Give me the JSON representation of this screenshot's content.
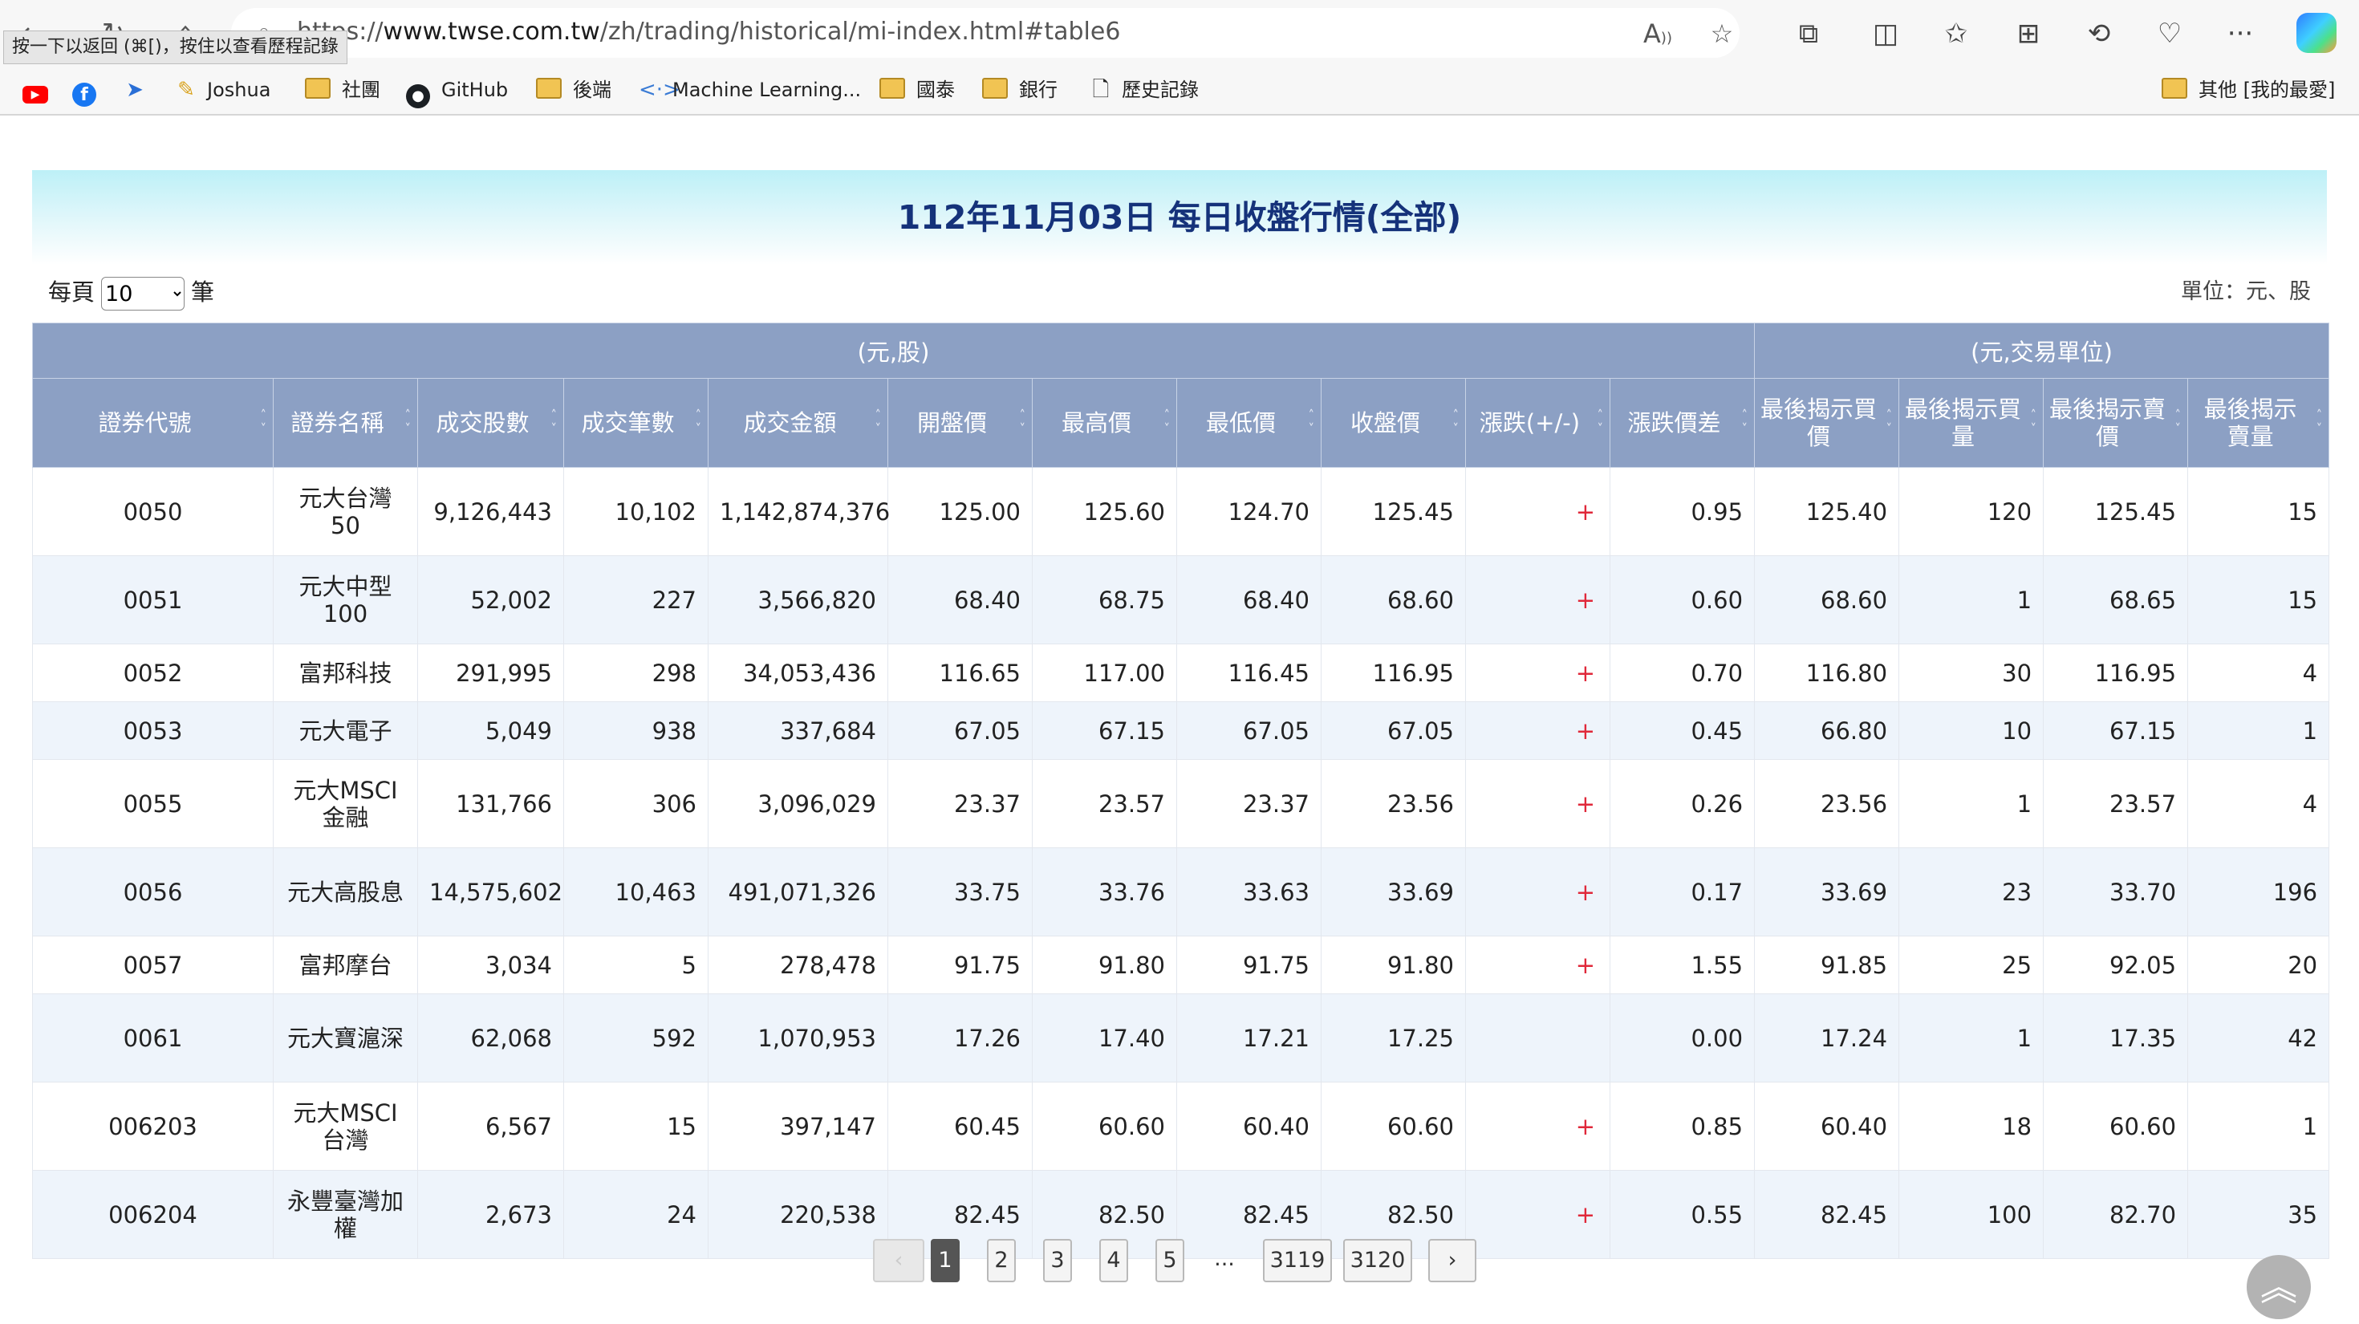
{
  "browser": {
    "url_prefix": "https://",
    "url_host": "www.twse.com.tw",
    "url_path": "/zh/trading/historical/mi-index.html#table6",
    "back_tooltip": "按一下以返回 (⌘[)，按住以查看歷程記錄"
  },
  "bookmarks": {
    "items": [
      {
        "label": "",
        "icon": "youtube-icon"
      },
      {
        "label": "",
        "icon": "facebook-icon"
      },
      {
        "label": "",
        "icon": "send-icon"
      },
      {
        "label": "Joshua",
        "icon": "pencil-icon"
      },
      {
        "label": "社團",
        "icon": "folder-icon"
      },
      {
        "label": "GitHub",
        "icon": "github-icon"
      },
      {
        "label": "後端",
        "icon": "folder-icon"
      },
      {
        "label": "Machine Learning...",
        "icon": "code-icon"
      },
      {
        "label": "國泰",
        "icon": "folder-icon"
      },
      {
        "label": "銀行",
        "icon": "folder-icon"
      },
      {
        "label": "歷史記錄",
        "icon": "page-icon"
      }
    ],
    "other": "其他 [我的最愛]"
  },
  "page": {
    "title": "112年11月03日 每日收盤行情(全部)",
    "per_page_label": "每頁",
    "per_page_value": "10",
    "per_page_suffix": "筆",
    "unit_label": "單位：元、股"
  },
  "table": {
    "groups": [
      "(元,股)",
      "(元,交易單位)"
    ],
    "headers": [
      "證券代號",
      "證券名稱",
      "成交股數",
      "成交筆數",
      "成交金額",
      "開盤價",
      "最高價",
      "最低價",
      "收盤價",
      "漲跌(+/-)",
      "漲跌價差",
      "最後揭示買價",
      "最後揭示買量",
      "最後揭示賣價",
      "最後揭示賣量"
    ],
    "rows": [
      [
        "0050",
        "元大台灣50",
        "9,126,443",
        "10,102",
        "1,142,874,376",
        "125.00",
        "125.60",
        "124.70",
        "125.45",
        "+",
        "0.95",
        "125.40",
        "120",
        "125.45",
        "15"
      ],
      [
        "0051",
        "元大中型100",
        "52,002",
        "227",
        "3,566,820",
        "68.40",
        "68.75",
        "68.40",
        "68.60",
        "+",
        "0.60",
        "68.60",
        "1",
        "68.65",
        "15"
      ],
      [
        "0052",
        "富邦科技",
        "291,995",
        "298",
        "34,053,436",
        "116.65",
        "117.00",
        "116.45",
        "116.95",
        "+",
        "0.70",
        "116.80",
        "30",
        "116.95",
        "4"
      ],
      [
        "0053",
        "元大電子",
        "5,049",
        "938",
        "337,684",
        "67.05",
        "67.15",
        "67.05",
        "67.05",
        "+",
        "0.45",
        "66.80",
        "10",
        "67.15",
        "1"
      ],
      [
        "0055",
        "元大MSCI金融",
        "131,766",
        "306",
        "3,096,029",
        "23.37",
        "23.57",
        "23.37",
        "23.56",
        "+",
        "0.26",
        "23.56",
        "1",
        "23.57",
        "4"
      ],
      [
        "0056",
        "元大高股息",
        "14,575,602",
        "10,463",
        "491,071,326",
        "33.75",
        "33.76",
        "33.63",
        "33.69",
        "+",
        "0.17",
        "33.69",
        "23",
        "33.70",
        "196"
      ],
      [
        "0057",
        "富邦摩台",
        "3,034",
        "5",
        "278,478",
        "91.75",
        "91.80",
        "91.75",
        "91.80",
        "+",
        "1.55",
        "91.85",
        "25",
        "92.05",
        "20"
      ],
      [
        "0061",
        "元大寶滬深",
        "62,068",
        "592",
        "1,070,953",
        "17.26",
        "17.40",
        "17.21",
        "17.25",
        "",
        "0.00",
        "17.24",
        "1",
        "17.35",
        "42"
      ],
      [
        "006203",
        "元大MSCI台灣",
        "6,567",
        "15",
        "397,147",
        "60.45",
        "60.60",
        "60.40",
        "60.60",
        "+",
        "0.85",
        "60.40",
        "18",
        "60.60",
        "1"
      ],
      [
        "006204",
        "永豐臺灣加權",
        "2,673",
        "24",
        "220,538",
        "82.45",
        "82.50",
        "82.45",
        "82.50",
        "+",
        "0.55",
        "82.45",
        "100",
        "82.70",
        "35"
      ]
    ]
  },
  "pagination": {
    "prev": "‹",
    "pages": [
      "1",
      "2",
      "3",
      "4",
      "5"
    ],
    "ellipsis": "...",
    "last_pages": [
      "3119",
      "3120"
    ],
    "next": "›",
    "current": "1"
  },
  "colors": {
    "header_bg": "#8ca0c4",
    "title_color": "#15327a",
    "up_sign": "#e0283a",
    "row_alt": "#eef4fb"
  }
}
